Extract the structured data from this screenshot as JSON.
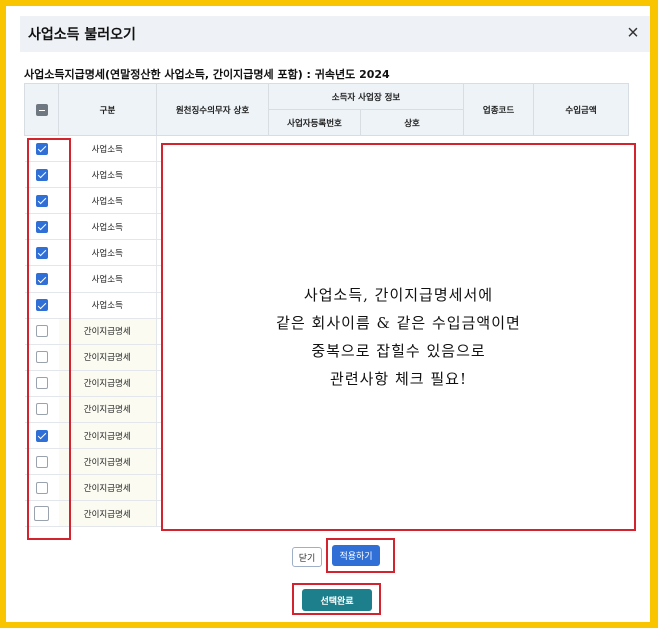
{
  "dialog": {
    "title": "사업소득 불러오기",
    "close_icon": "×"
  },
  "subtitle": "사업소득지급명세(연말정산한 사업소득, 간이지급명세 포함) : 귀속년도 2024",
  "table": {
    "headers": {
      "gubun": "구분",
      "payer": "원천징수의무자 상호",
      "group": "소득자 사업장 정보",
      "bizno": "사업자등록번호",
      "name": "상호",
      "industry": "업종코드",
      "income": "수입금액"
    },
    "rows": [
      {
        "checked": true,
        "gubun": "사업소득"
      },
      {
        "checked": true,
        "gubun": "사업소득"
      },
      {
        "checked": true,
        "gubun": "사업소득"
      },
      {
        "checked": true,
        "gubun": "사업소득"
      },
      {
        "checked": true,
        "gubun": "사업소득"
      },
      {
        "checked": true,
        "gubun": "사업소득"
      },
      {
        "checked": true,
        "gubun": "사업소득"
      },
      {
        "checked": false,
        "gubun": "간이지급명세"
      },
      {
        "checked": false,
        "gubun": "간이지급명세"
      },
      {
        "checked": false,
        "gubun": "간이지급명세"
      },
      {
        "checked": false,
        "gubun": "간이지급명세"
      },
      {
        "checked": true,
        "gubun": "간이지급명세"
      },
      {
        "checked": false,
        "gubun": "간이지급명세"
      },
      {
        "checked": false,
        "gubun": "간이지급명세"
      },
      {
        "checked": false,
        "gubun": "간이지급명세"
      }
    ]
  },
  "note": {
    "lines": [
      "사업소득, 간이지급명세서에",
      "같은 회사이름 & 같은 수입금액이면",
      "중복으로 잡힐수 있음으로",
      "관련사항 체크 필요!"
    ]
  },
  "buttons": {
    "close": "닫기",
    "apply": "적용하기",
    "done": "선택완료"
  },
  "colors": {
    "frame": "#f9c400",
    "annotation": "#d3232f",
    "primary": "#2f6fd6",
    "done": "#1e7f8c"
  }
}
